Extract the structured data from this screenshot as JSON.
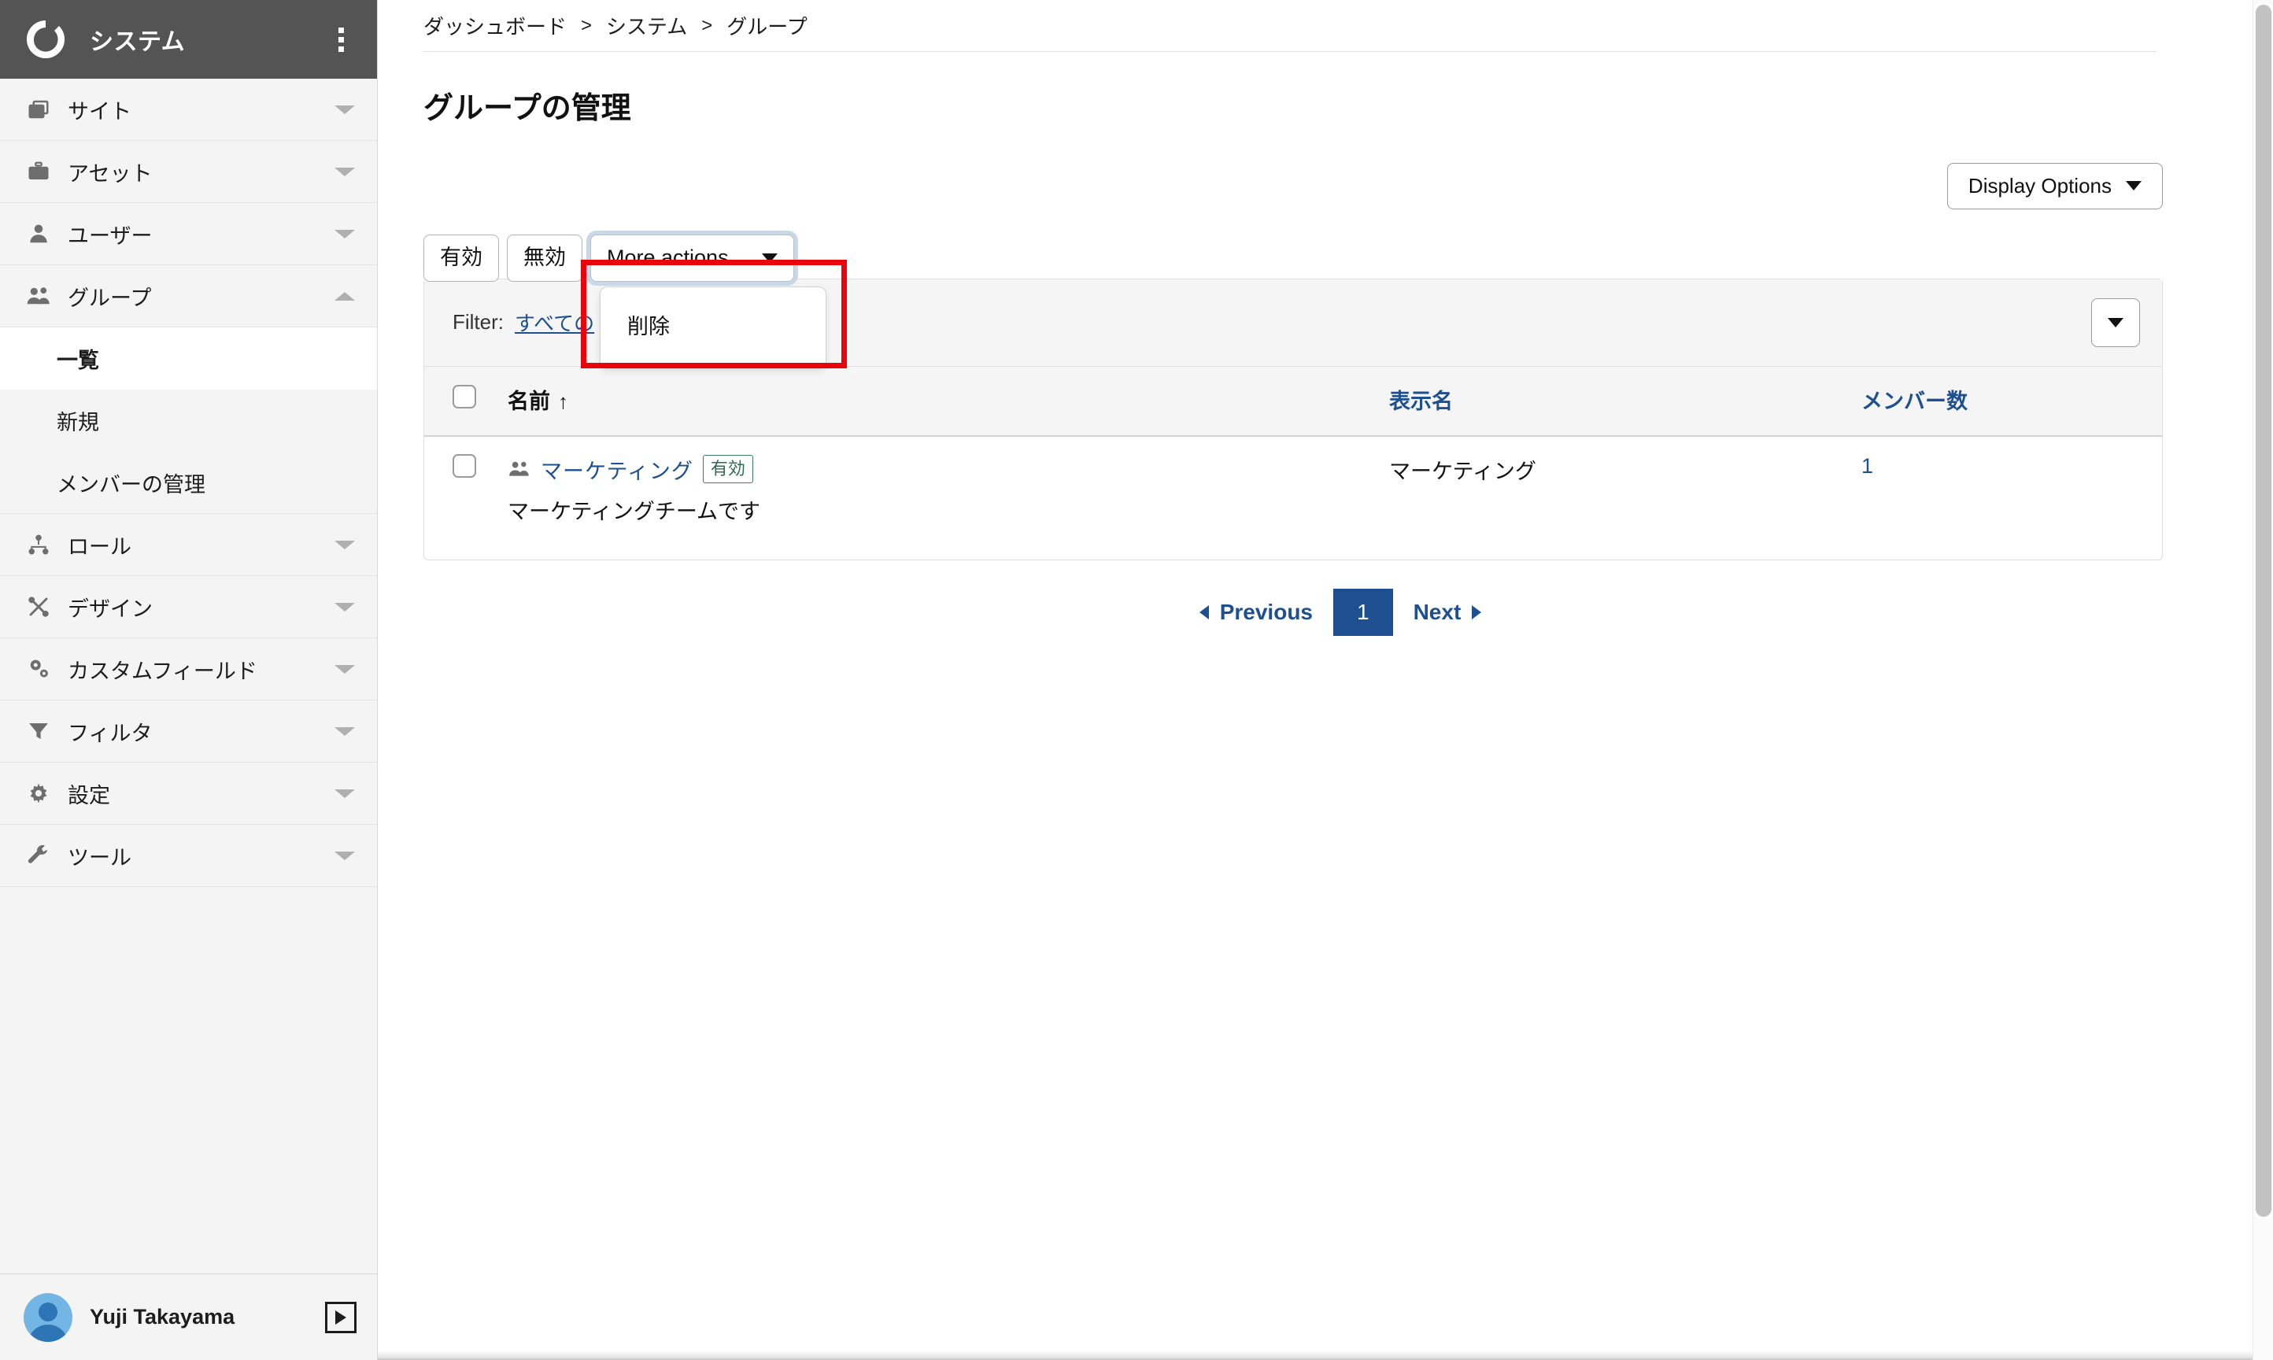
{
  "sidebar": {
    "brand": "システム",
    "logo_icon": "ring-logo-icon",
    "kebab_icon": "kebab-menu-icon",
    "items": [
      {
        "label": "サイト",
        "icon": "sites-icon",
        "caret": "down"
      },
      {
        "label": "アセット",
        "icon": "briefcase-icon",
        "caret": "down"
      },
      {
        "label": "ユーザー",
        "icon": "user-icon",
        "caret": "down"
      },
      {
        "label": "グループ",
        "icon": "group-icon",
        "caret": "up"
      }
    ],
    "subitems": [
      {
        "label": "一覧",
        "active": true
      },
      {
        "label": "新規",
        "active": false
      },
      {
        "label": "メンバーの管理",
        "active": false
      }
    ],
    "items_after": [
      {
        "label": "ロール",
        "icon": "hierarchy-icon",
        "caret": "down"
      },
      {
        "label": "デザイン",
        "icon": "design-brush-icon",
        "caret": "down"
      },
      {
        "label": "カスタムフィールド",
        "icon": "gears-icon",
        "caret": "down"
      },
      {
        "label": "フィルタ",
        "icon": "funnel-icon",
        "caret": "down"
      },
      {
        "label": "設定",
        "icon": "gear-icon",
        "caret": "down"
      },
      {
        "label": "ツール",
        "icon": "wrench-icon",
        "caret": "down"
      }
    ],
    "footer": {
      "user_name": "Yuji Takayama",
      "avatar_icon": "user-avatar-icon",
      "collapse_icon": "collapse-panel-icon"
    }
  },
  "breadcrumb": {
    "items": [
      "ダッシュボード",
      "システム",
      "グループ"
    ],
    "separator": ">"
  },
  "page": {
    "title": "グループの管理"
  },
  "display_options": {
    "label": "Display Options",
    "caret_icon": "chevron-down-icon"
  },
  "toolbar": {
    "enable_label": "有効",
    "disable_label": "無効",
    "more_actions_label": "More actions...",
    "more_actions_caret_icon": "chevron-down-icon",
    "menu_items": [
      "削除"
    ]
  },
  "filter_bar": {
    "label": "Filter:",
    "value": "すべての",
    "caret_button_icon": "chevron-down-icon"
  },
  "table": {
    "headers": {
      "check": "",
      "name": "名前",
      "name_sort_icon": "sort-ascending-arrow",
      "display_name": "表示名",
      "member_count": "メンバー数"
    },
    "rows": [
      {
        "checked": false,
        "icon": "group-icon",
        "name": "マーケティング",
        "status_badge": "有効",
        "description": "マーケティングチームです",
        "display_name": "マーケティング",
        "member_count": "1"
      }
    ]
  },
  "pagination": {
    "previous": "Previous",
    "next": "Next",
    "current_page": "1",
    "prev_icon": "triangle-left-icon",
    "next_icon": "triangle-right-icon"
  },
  "colors": {
    "sidebar_header_bg": "#545454",
    "link_blue": "#1d4f91",
    "badge_green": "#2f6b53",
    "highlight_red": "#e8050b",
    "pager_active_bg": "#1d4f91"
  }
}
